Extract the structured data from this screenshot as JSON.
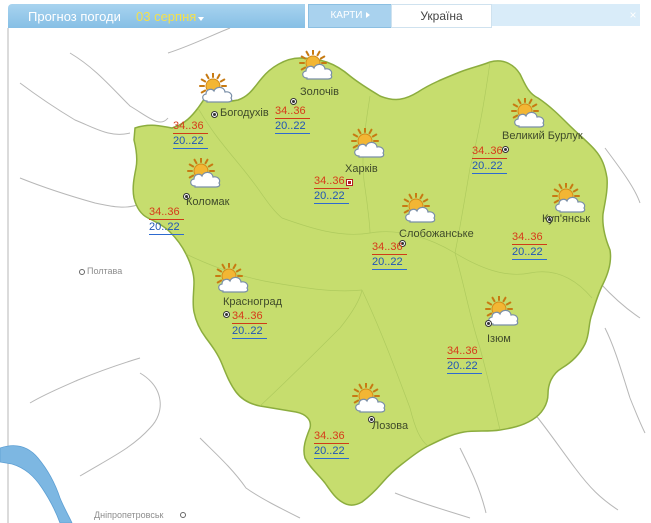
{
  "header": {
    "title": "Прогноз погоди",
    "date": "03 серпня",
    "maps_tab": "КАРТИ",
    "region_tab": "Україна"
  },
  "colors": {
    "region_fill": "#c6dd6e",
    "region_stroke": "#8cad3e",
    "water": "#7db7e2",
    "day_temp": "#d63a1a",
    "night_temp": "#1f54b8",
    "header_bg": "#9ccbeb",
    "header_date": "#f5e04a"
  },
  "map": {
    "stations": [
      {
        "name": "Богодухів",
        "day": "34..36",
        "night": "20..22",
        "icon": "partly-cloudy-icon"
      },
      {
        "name": "Золочів",
        "day": "34..36",
        "night": "20..22",
        "icon": "partly-cloudy-icon"
      },
      {
        "name": "Великий Бурлук",
        "day": "34..36",
        "night": "20..22",
        "icon": "partly-cloudy-icon"
      },
      {
        "name": "Харків",
        "day": "34..36",
        "night": "20..22",
        "icon": "partly-cloudy-icon"
      },
      {
        "name": "Коломак",
        "day": "34..36",
        "night": "20..22",
        "icon": "partly-cloudy-icon"
      },
      {
        "name": "Слобожанське",
        "day": "34..36",
        "night": "20..22",
        "icon": "partly-cloudy-icon"
      },
      {
        "name": "Куп'янськ",
        "day": "34..36",
        "night": "20..22",
        "icon": "partly-cloudy-icon"
      },
      {
        "name": "Красноград",
        "day": "34..36",
        "night": "20..22",
        "icon": "partly-cloudy-icon"
      },
      {
        "name": "Ізюм",
        "day": "34..36",
        "night": "20..22",
        "icon": "partly-cloudy-icon"
      },
      {
        "name": "Лозова",
        "day": "34..36",
        "night": "20..22",
        "icon": "partly-cloudy-icon"
      }
    ],
    "outside_cities": [
      {
        "name": "Полтава"
      },
      {
        "name": "Дніпропетровськ"
      }
    ]
  }
}
